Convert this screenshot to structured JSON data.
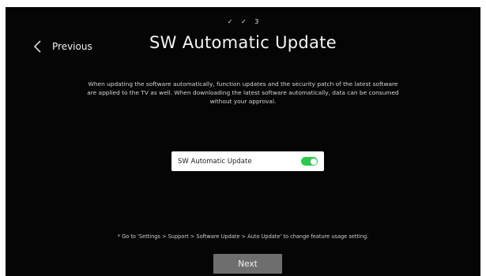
{
  "steps": {
    "step1": "✓",
    "step2": "✓",
    "step3": "3"
  },
  "header": {
    "back_label": "Previous",
    "back_icon": "chevron-left-icon",
    "title": "SW Automatic Update"
  },
  "description": {
    "line1": "When updating the software automatically, function updates and the security patch of the latest software",
    "line2": "are applied to the TV as well. When downloading the latest software automatically, data can be consumed",
    "line3": "without your approval."
  },
  "setting": {
    "label": "SW Automatic Update",
    "enabled": true,
    "toggle_color": "#2ec84e"
  },
  "footnote": "* Go to 'Settings > Support > Software Update > Auto Update' to change feature usage setting.",
  "next_label": "Next"
}
